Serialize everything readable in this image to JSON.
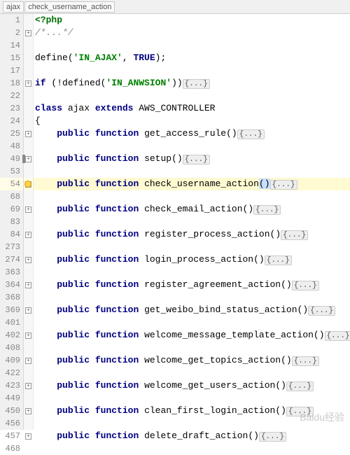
{
  "breadcrumb": {
    "seg1": "ajax",
    "seg2": "check_username_action"
  },
  "sym": {
    "php_open": "<?php",
    "cmt": "/*...*/",
    "define": "define",
    "in_ajax": "'IN_AJAX'",
    "true": "TRUE",
    "if": "if",
    "bang": " (!",
    "defined": "defined",
    "in_anwsion": "'IN_ANWSION'",
    "close_if": "))",
    "fold": "{...}",
    "class": "class",
    "ajax": " ajax ",
    "extends": "extends",
    "controller": " AWS_CONTROLLER",
    "brace_open": "{",
    "public": "public",
    "function": "function",
    "empty_parens": "()",
    "paren_o": "(",
    "paren_c": ")"
  },
  "fn": {
    "get_access_rule": "get_access_rule",
    "setup": "setup",
    "check_username_action": "check_username_action",
    "check_email_action": "check_email_action",
    "register_process_action": "register_process_action",
    "login_process_action": "login_process_action",
    "register_agreement_action": "register_agreement_action",
    "get_weibo_bind_status_action": "get_weibo_bind_status_action",
    "welcome_message_template_action": "welcome_message_template_action",
    "welcome_get_topics_action": "welcome_get_topics_action",
    "welcome_get_users_action": "welcome_get_users_action",
    "clean_first_login_action": "clean_first_login_action",
    "delete_draft_action": "delete_draft_action"
  },
  "ln": {
    "l1": "1",
    "l2": "2",
    "l14": "14",
    "l15": "15",
    "l17": "17",
    "l18": "18",
    "l22": "22",
    "l23": "23",
    "l24": "24",
    "l25": "25",
    "l48": "48",
    "l49": "49",
    "l53": "53",
    "l54": "54",
    "l68": "68",
    "l69": "69",
    "l83": "83",
    "l84": "84",
    "l273": "273",
    "l274": "274",
    "l363": "363",
    "l364": "364",
    "l368": "368",
    "l369": "369",
    "l401": "401",
    "l402": "402",
    "l408": "408",
    "l409": "409",
    "l422": "422",
    "l423": "423",
    "l449": "449",
    "l450": "450",
    "l456": "456",
    "l457": "457",
    "l468": "468"
  },
  "watermark": "Baidu经验"
}
